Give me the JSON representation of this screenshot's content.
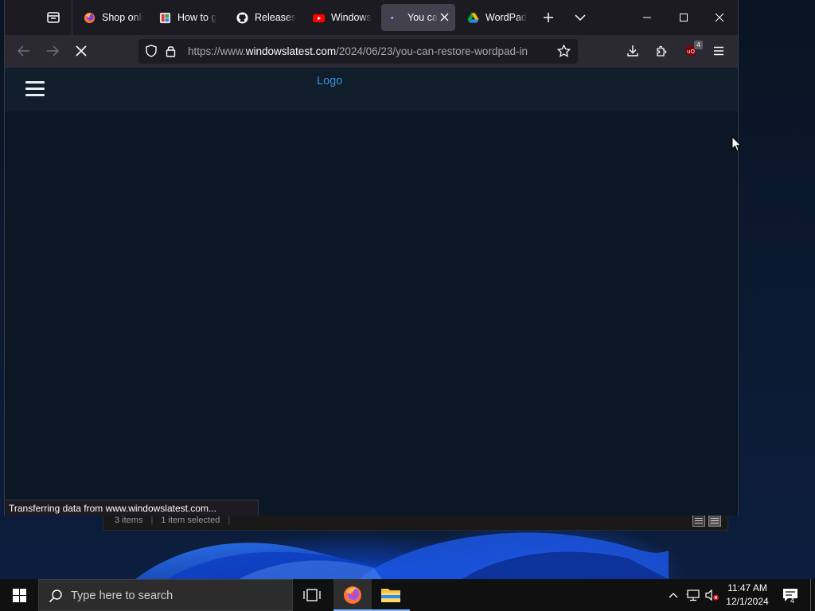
{
  "browser": {
    "tabs": [
      {
        "title": "Shop onli",
        "icon": "firefox-icon",
        "active": false
      },
      {
        "title": "How to g",
        "icon": "site-favicon-icon",
        "active": false
      },
      {
        "title": "Releases",
        "icon": "github-icon",
        "active": false
      },
      {
        "title": "Windows",
        "icon": "youtube-icon",
        "active": false
      },
      {
        "title": "You ca",
        "icon": "loading-dot-icon",
        "active": true
      },
      {
        "title": "WordPad",
        "icon": "google-drive-icon",
        "active": false
      }
    ],
    "url": {
      "prefix": "https://www.",
      "host": "windowslatest.com",
      "path": "/2024/06/23/you-can-restore-wordpad-in"
    },
    "extension_badge": "4",
    "status_text": "Transferring data from www.windowslatest.com..."
  },
  "page": {
    "logo_text": "Logo"
  },
  "explorer": {
    "items_count": "3 items",
    "selection": "1 item selected"
  },
  "taskbar": {
    "search_placeholder": "Type here to search",
    "time": "11:47 AM",
    "date": "12/1/2024",
    "notification_count": "4"
  },
  "colors": {
    "page_background": "#0b1724",
    "site_header": "#101e2b",
    "logo_link": "#3b8fd9",
    "tab_active": "#42414d",
    "taskbar": "#101010"
  }
}
